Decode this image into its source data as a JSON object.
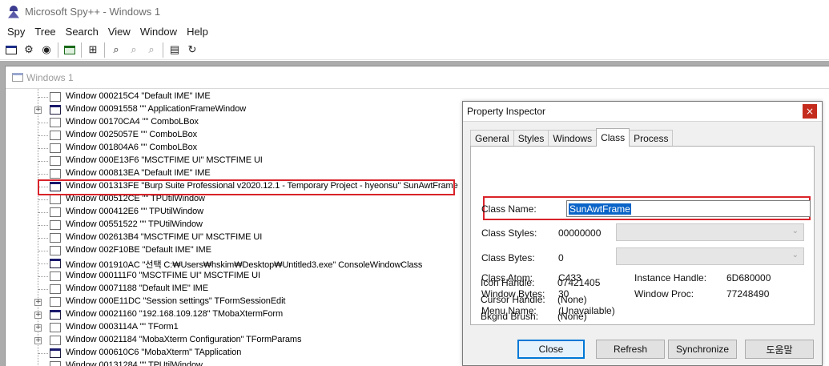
{
  "window": {
    "title": "Microsoft Spy++ - Windows 1"
  },
  "menu": [
    "Spy",
    "Tree",
    "Search",
    "View",
    "Window",
    "Help"
  ],
  "toolbar": {
    "icons": [
      "window-list-icon",
      "processes-icon",
      "threads-icon",
      "messages-icon",
      "find-window-icon",
      "find-icon",
      "find-next-icon",
      "find-prev-icon",
      "properties-icon",
      "refresh-icon"
    ]
  },
  "child": {
    "title": "Windows 1"
  },
  "tree": {
    "rows": [
      {
        "text": "Window 000215C4 \"Default IME\" IME",
        "expander": "",
        "visible": false
      },
      {
        "text": "Window 00091558 \"\" ApplicationFrameWindow",
        "expander": "+",
        "visible": true
      },
      {
        "text": "Window 00170CA4 \"\" ComboLBox",
        "expander": "",
        "visible": false
      },
      {
        "text": "Window 0025057E \"\" ComboLBox",
        "expander": "",
        "visible": false
      },
      {
        "text": "Window 001804A6 \"\" ComboLBox",
        "expander": "",
        "visible": false
      },
      {
        "text": "Window 000E13F6 \"MSCTFIME UI\" MSCTFIME UI",
        "expander": "",
        "visible": false
      },
      {
        "text": "Window 000813EA \"Default IME\" IME",
        "expander": "",
        "visible": false
      },
      {
        "text": "Window 001313FE \"Burp Suite Professional v2020.12.1 - Temporary Project - hyeonsu\" SunAwtFrame",
        "expander": "",
        "visible": true
      },
      {
        "text": "Window 000512CE \"\" TPUtilWindow",
        "expander": "",
        "visible": false
      },
      {
        "text": "Window 000412E6 \"\" TPUtilWindow",
        "expander": "",
        "visible": false
      },
      {
        "text": "Window 00551522 \"\" TPUtilWindow",
        "expander": "",
        "visible": false
      },
      {
        "text": "Window 002613B4 \"MSCTFIME UI\" MSCTFIME UI",
        "expander": "",
        "visible": false
      },
      {
        "text": "Window 002F10BE \"Default IME\" IME",
        "expander": "",
        "visible": false
      },
      {
        "text": "Window 001910AC \"선택 C:₩Users₩hskim₩Desktop₩Untitled3.exe\" ConsoleWindowClass",
        "expander": "",
        "visible": true
      },
      {
        "text": "Window 000111F0 \"MSCTFIME UI\" MSCTFIME UI",
        "expander": "",
        "visible": false
      },
      {
        "text": "Window 00071188 \"Default IME\" IME",
        "expander": "",
        "visible": false
      },
      {
        "text": "Window 000E11DC \"Session settings\" TFormSessionEdit",
        "expander": "+",
        "visible": false
      },
      {
        "text": "Window 00021160 \"192.168.109.128\" TMobaXtermForm",
        "expander": "+",
        "visible": true
      },
      {
        "text": "Window 0003114A \"\" TForm1",
        "expander": "+",
        "visible": false
      },
      {
        "text": "Window 00021184 \"MobaXterm Configuration\" TFormParams",
        "expander": "+",
        "visible": false
      },
      {
        "text": "Window 000610C6 \"MobaXterm\" TApplication",
        "expander": "",
        "visible": true
      },
      {
        "text": "Window 00131284 \"\" TPUtilWindow",
        "expander": "",
        "visible": false
      }
    ]
  },
  "dialog": {
    "title": "Property Inspector",
    "close_glyph": "×",
    "tabs": [
      "General",
      "Styles",
      "Windows",
      "Class",
      "Process"
    ],
    "active_tab": "Class",
    "class_name_label": "Class Name:",
    "class_name_value": "SunAwtFrame",
    "class_styles_label": "Class Styles:",
    "class_styles_value": "00000000",
    "class_bytes_label": "Class Bytes:",
    "class_bytes_value": "0",
    "class_atom_label": "Class Atom:",
    "class_atom_value": "C433",
    "instance_handle_label": "Instance Handle:",
    "instance_handle_value": "6D680000",
    "window_bytes_label": "Window Bytes:",
    "window_bytes_value": "30",
    "window_proc_label": "Window Proc:",
    "window_proc_value": "77248490",
    "menu_name_label": "Menu Name:",
    "menu_name_value": "(Unavailable)",
    "icon_handle_label": "Icon Handle:",
    "icon_handle_value": "07421405",
    "cursor_handle_label": "Cursor Handle:",
    "cursor_handle_value": "(None)",
    "bkgnd_brush_label": "Bkgnd Brush:",
    "bkgnd_brush_value": "(None)",
    "buttons": {
      "close": "Close",
      "refresh": "Refresh",
      "synchronize": "Synchronize",
      "help": "도움말"
    }
  },
  "colors": {
    "highlight_border": "#d9232a",
    "selection": "#0a64c8",
    "mdi_background": "#acacac"
  }
}
